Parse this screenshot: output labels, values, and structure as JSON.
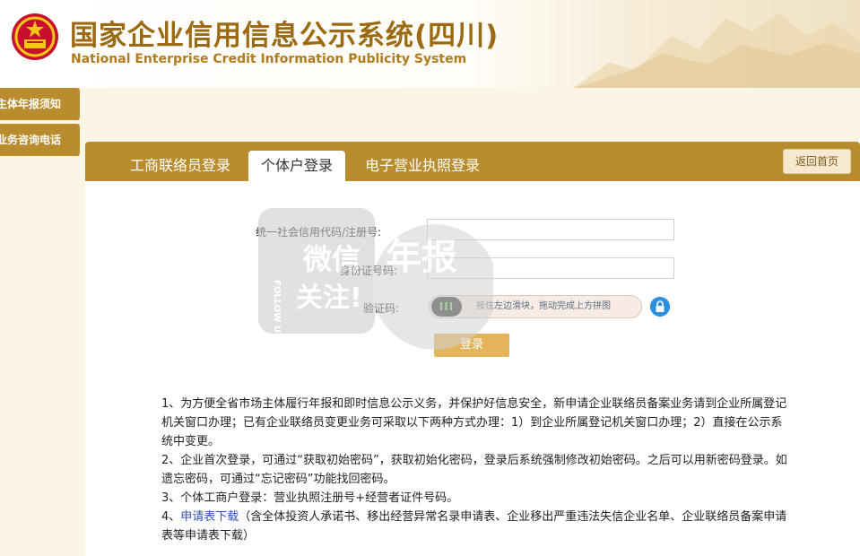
{
  "header": {
    "title_cn": "国家企业信用信息公示系统(四川)",
    "title_en": "National Enterprise Credit Information Publicity System"
  },
  "sidebar": {
    "items": [
      {
        "label": "主体年报须知"
      },
      {
        "label": "业务咨询电话"
      }
    ]
  },
  "tabs": [
    {
      "label": "工商联络员登录"
    },
    {
      "label": "个体户登录",
      "active": true
    },
    {
      "label": "电子营业执照登录"
    }
  ],
  "back_button": "返回首页",
  "form": {
    "credit_code_label": "统一社会信用代码/注册号:",
    "credit_code_value": "",
    "id_label": "身份证号码:",
    "id_value": "",
    "captcha_label": "验证码:",
    "slider_knob": "III",
    "slider_hint": "按住左边滑块，拖动完成上方拼图",
    "login_button": "登录"
  },
  "notes": {
    "n1": "1、为方便全省市场主体履行年报和即时信息公示义务，并保护好信息安全，新申请企业联络员备案业务请到企业所属登记机关窗口办理；已有企业联络员变更业务可采取以下两种方式办理：1）到企业所属登记机关窗口办理；2）直接在公示系统中变更。",
    "n2": "2、企业首次登录，可通过“获取初始密码”，获取初始化密码，登录后系统强制修改初始密码。之后可以用新密码登录。如遗忘密码，可通过“忘记密码”功能找回密码。",
    "n3": "3、个体工商户登录：营业执照注册号+经营者证件号码。",
    "n4_prefix": "4、",
    "n4_link": "申请表下载",
    "n4_suffix": "（含全体投资人承诺书、移出经营异常名录申请表、企业移出严重违法失信企业名单、企业联络员备案申请表等申请表下载）"
  },
  "watermark": {
    "follow": "FOLLOW US",
    "line1": "微信",
    "line2": "关注!",
    "big": "年报"
  },
  "colors": {
    "brand_gold": "#b98c2e",
    "title_brown": "#9b6a12",
    "login_orange": "#e4b35a",
    "link_blue": "#2f4fb8",
    "lock_blue": "#2d8fe0"
  }
}
